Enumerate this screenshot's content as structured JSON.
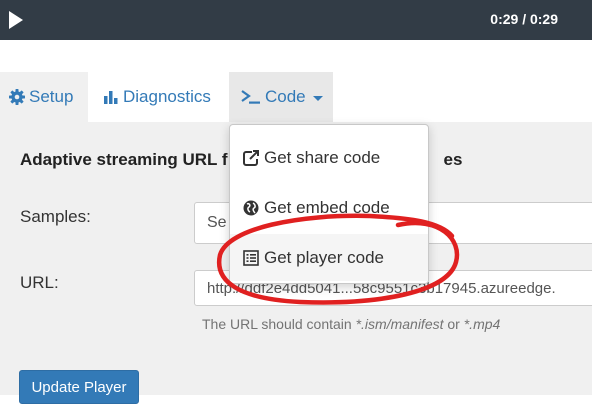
{
  "player": {
    "time": "0:29 / 0:29",
    "bar_color": "#323c46"
  },
  "tabs": [
    {
      "label": "Setup",
      "icon": "gear-icon"
    },
    {
      "label": "Diagnostics",
      "icon": "bar-chart-icon"
    },
    {
      "label": "Code",
      "icon": "terminal-icon"
    }
  ],
  "main": {
    "section_title_start": "Adaptive streaming URL f",
    "section_title_end": "es",
    "samples_label": "Samples:",
    "samples_value": "Se",
    "url_label": "URL:",
    "url_value": "http://ddf2e4dd5041...58c9551c3b17945.azureedge.",
    "help_prefix": "The URL should contain ",
    "help_manifest": "*.ism/manifest",
    "help_or": " or ",
    "help_mp4": "*.mp4",
    "update_button": "Update Player"
  },
  "dropdown": {
    "items": [
      {
        "label": "Get share code",
        "icon": "share-icon"
      },
      {
        "label": "Get embed code",
        "icon": "globe-icon"
      },
      {
        "label": "Get player code",
        "icon": "list-icon"
      }
    ]
  },
  "colors": {
    "link": "#337ab7",
    "annotation": "#e02020",
    "panel": "#f0f0f0"
  }
}
